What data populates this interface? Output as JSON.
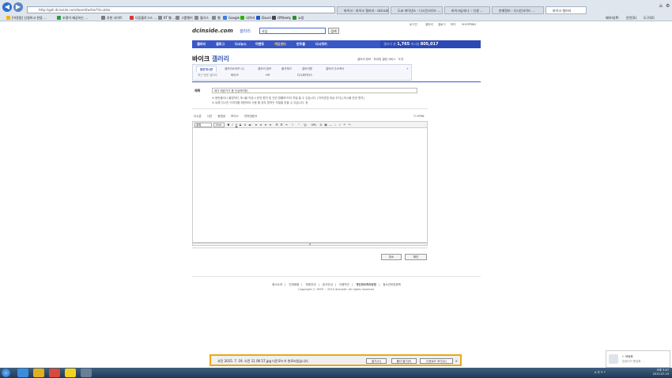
{
  "browser": {
    "address": "http://gall.dcinside.com/board/write/?id=bike",
    "tabs": [
      {
        "label": "바이크 : 바이크 갤러리 - dcinside",
        "active": false
      },
      {
        "label": "도쿄 파이낸스 : 디시인사이드 ...",
        "active": false
      },
      {
        "label": "바이크남자다 :: 인생 ...",
        "active": false
      },
      {
        "label": "판매정보 : 디시인사이드 ...",
        "active": false
      },
      {
        "label": "바이크 갤러리",
        "active": true
      }
    ],
    "favorites": [
      "[아동법] 신청하고 한동 ...",
      "조명이 제공하는 ...",
      "추천 사이트",
      "다음블로그스 ...",
      "KT 웹 ...",
      "그룹웨어",
      "월가스",
      "웹",
      "Google",
      "네이버",
      "Daum",
      "Offdeety",
      "쇼핑"
    ],
    "tools": [
      "페이지(P)",
      "안전(S)",
      "도구(O)"
    ]
  },
  "header": {
    "logo": "dcinside.com",
    "logo_sub": "갤러리",
    "search_value": "사업",
    "search_button": "검색",
    "top_links": [
      "로그인",
      "갤러리",
      "갤로그",
      "마이",
      "SHOPPING"
    ]
  },
  "gnb": {
    "items": [
      "갤러리",
      "갤로그",
      "디시뉴스",
      "이벤트",
      "게임센터",
      "만두몰",
      "디시위키"
    ],
    "stats_label": "갤러리 총",
    "stats_value": "1,765",
    "stats_label2": "게시물",
    "stats_value2": "805,017"
  },
  "gallery": {
    "title_main": "바이크",
    "title_sub": "갤러리",
    "tools": "갤러리 정보 · 부내정 갤럼 서비스 · 도전",
    "tabs": [
      "일반게시판",
      "갤러리소리모 (1)",
      "갤러리 정보",
      "출석체크",
      "갤러리원",
      "갤러리 주소복사"
    ],
    "sub_items": [
      "최근 방문 갤러리",
      "바이크",
      "HIT",
      "디시위키디스"
    ]
  },
  "form": {
    "title_label": "제목",
    "title_value": "제가 애완가가 좀 진상하려한..",
    "notice1": "※ 음란물이나 불법적인 게시물 작성시 운영 원칙 및 관련 법률에 따라 처벌 될 수 있습니다. [저작권법 대상 무지] [게시물 운영 원칙]",
    "notice2": "※ 유해 다시전 이미지를 제한하여 사용 할 경우 법적인 처벌을 받을 수 있습니다. 등",
    "editor_tabs": [
      "디시콘",
      "사진",
      "동영상",
      "보이스",
      "인터넷링크"
    ],
    "html_label": "HTML",
    "font_select": "굴림",
    "size_select": "10pt",
    "submit": "확인",
    "cancel": "취소"
  },
  "footer": {
    "links": [
      "회사소개",
      "인재채용",
      "제휴안내",
      "광고안내",
      "이용약관",
      "개인정보처리방침",
      "청소년보호정책"
    ],
    "copyright": "Copyright ⓒ 1999 ~ 2015 dcinside. All rights reserved."
  },
  "download_bar": {
    "text": "사진 2015. 7. 19. 오전 11 06 57.jpg 다운로드가 완료되었습니다.",
    "open": "열기(O)",
    "open_folder": "폴더 열기(P)",
    "view_downloads": "다운로드 보기(V)",
    "close": "×"
  },
  "toast": {
    "line1": "← 바탕화",
    "line2": "컴퓨터가 활성화 ..."
  },
  "taskbar": {
    "time": "오후 3:47",
    "date": "2015-07-19",
    "tray": "A 가 ✎ ?"
  },
  "colors": {
    "brand_blue": "#3a57c8",
    "download_border": "#e8a918"
  }
}
